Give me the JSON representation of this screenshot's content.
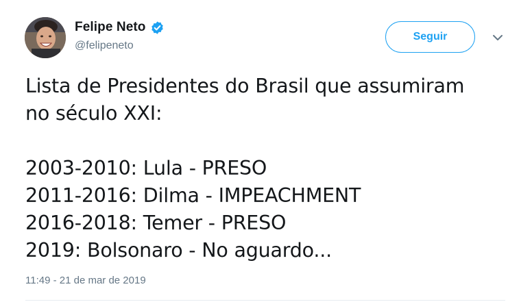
{
  "author": {
    "display_name": "Felipe Neto",
    "handle": "@felipeneto",
    "verified_icon": "verified-badge-icon"
  },
  "actions": {
    "follow_label": "Seguir",
    "more_icon": "chevron-down-icon"
  },
  "tweet": {
    "lines": [
      "Lista de Presidentes do Brasil que assumiram",
      "no século XXI:",
      "",
      "2003-2010: Lula - PRESO",
      "2011-2016: Dilma - IMPEACHMENT",
      "2016-2018: Temer - PRESO",
      "2019: Bolsonaro - No aguardo..."
    ],
    "timestamp": "11:49 - 21 de mar de 2019"
  },
  "colors": {
    "accent": "#1da1f2",
    "text": "#14171a",
    "muted": "#657786"
  }
}
